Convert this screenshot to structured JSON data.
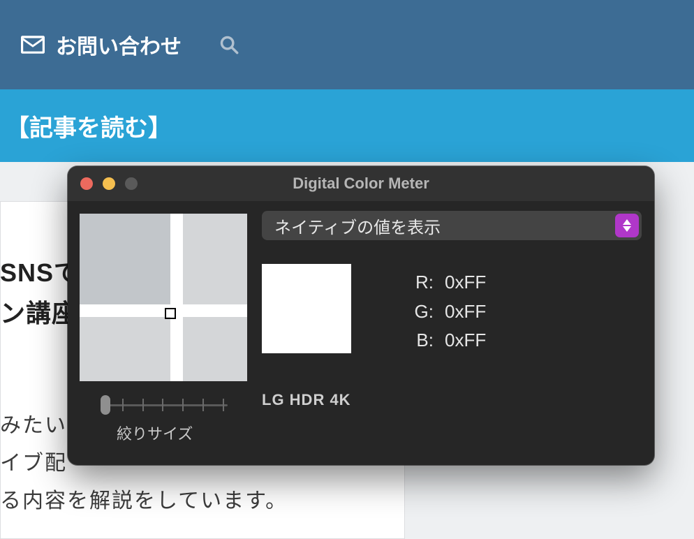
{
  "nav": {
    "contact_label": "お問い合わせ"
  },
  "banner": {
    "read_article": "【記事を読む】"
  },
  "bg_page": {
    "heading_line1": "SNSで",
    "heading_line2": "ン講座",
    "body_line1": "みたい",
    "body_line2": "イブ配",
    "body_line3": "る内容を解説をしています。"
  },
  "dcm": {
    "title": "Digital Color Meter",
    "mode_label": "ネイティブの値を表示",
    "rgb": {
      "r_label": "R:",
      "g_label": "G:",
      "b_label": "B:",
      "r_value": "0xFF",
      "g_value": "0xFF",
      "b_value": "0xFF"
    },
    "swatch_color": "#FFFFFF",
    "display_name": "LG HDR 4K",
    "aperture_label": "絞りサイズ"
  }
}
